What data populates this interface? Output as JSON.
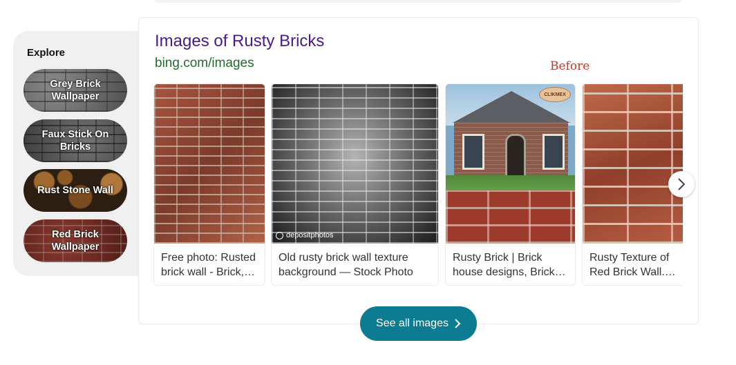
{
  "explore": {
    "title": "Explore",
    "items": [
      {
        "label": "Grey Brick Wallpaper"
      },
      {
        "label": "Faux Stick On Bricks"
      },
      {
        "label": "Rust Stone Wall"
      },
      {
        "label": "Red Brick Wallpaper"
      }
    ]
  },
  "card": {
    "title": "Images of Rusty Bricks",
    "source": "bing.com/images",
    "annotation": "Before",
    "images": [
      {
        "caption": "Free photo: Rusted brick wall - Brick, Wall, Rusted - Free Download"
      },
      {
        "caption": "Old rusty brick wall texture background — Stock Photo",
        "watermark": "depositphotos"
      },
      {
        "caption": "Rusty Brick | Brick house designs, Brick houses",
        "badge": "CLIKMEX"
      },
      {
        "caption": "Rusty Texture of Red Brick Wall. Stock Photo"
      }
    ],
    "next_icon": "chevron-right-icon",
    "see_all_label": "See all images"
  },
  "colors": {
    "title": "#4a1a8c",
    "source": "#1e6b2c",
    "button": "#0c7c93",
    "annotation": "#c0392b"
  }
}
